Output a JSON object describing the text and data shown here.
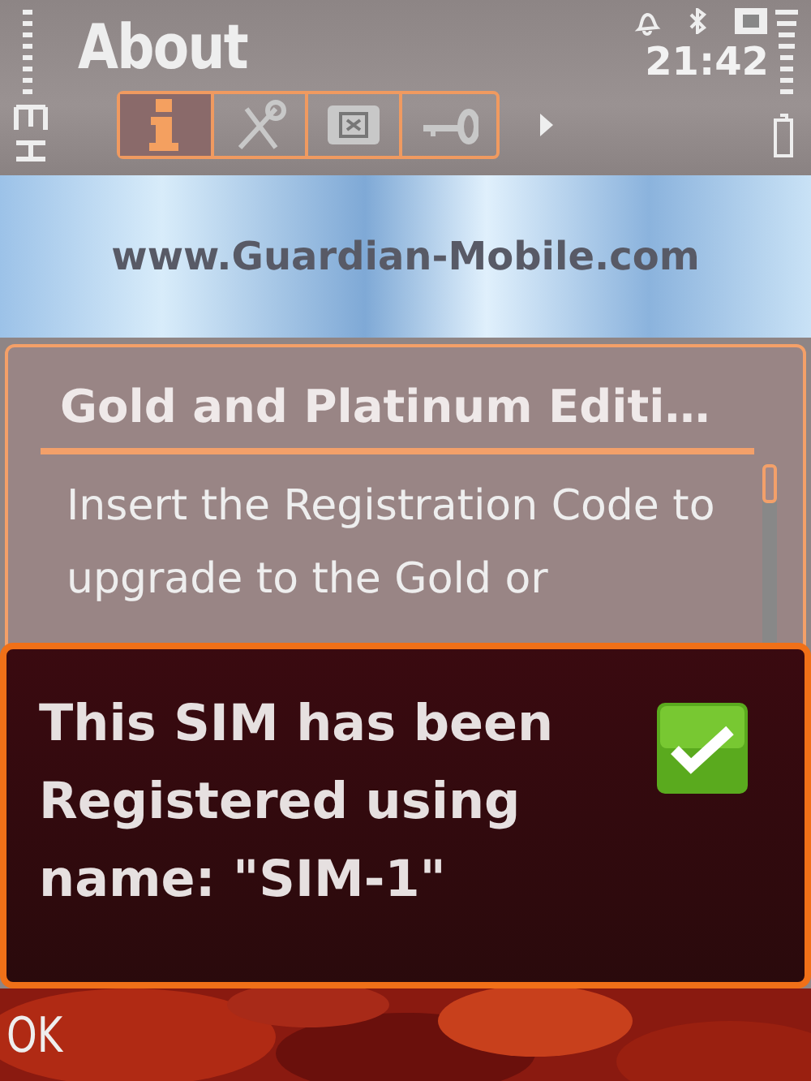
{
  "header": {
    "title": "About",
    "time": "21:42"
  },
  "tabs": [
    {
      "kind": "info",
      "selected": true
    },
    {
      "kind": "tools",
      "selected": false
    },
    {
      "kind": "card",
      "selected": false
    },
    {
      "kind": "key",
      "selected": false
    }
  ],
  "banner": {
    "text": "www.Guardian-Mobile.com"
  },
  "panel": {
    "heading": "Gold and Platinum Editi…",
    "body_lines": [
      "Insert the Registration Code to",
      "upgrade to the Gold or"
    ]
  },
  "dialog": {
    "message_lines": [
      "This SIM has been",
      "Registered using",
      "name: \"SIM-1\""
    ]
  },
  "softkeys": {
    "left": "OK"
  }
}
